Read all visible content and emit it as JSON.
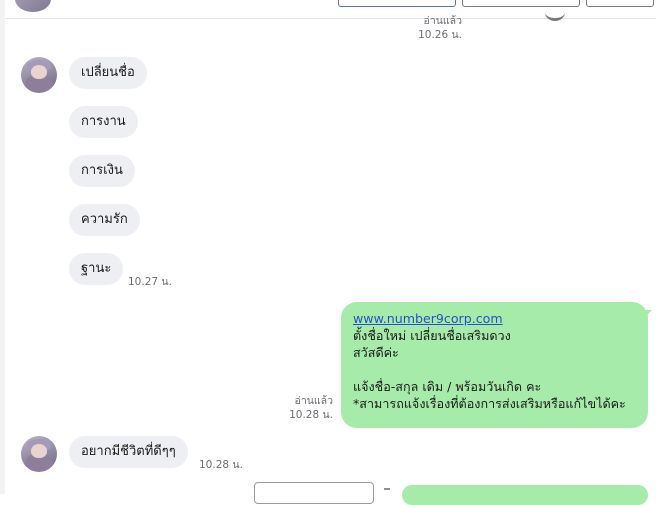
{
  "read_top": {
    "status": "อ่านแล้ว",
    "time": "10.26 น."
  },
  "incoming_group_1": {
    "messages": [
      "เปลี่ยนชื่อ",
      "การงาน",
      "การเงิน",
      "ความรัก",
      "ฐานะ"
    ],
    "time": "10.27 น."
  },
  "outgoing": {
    "link": "www.number9corp.com",
    "lines": [
      "ตั้งชื่อใหม่ เปลี่ยนชื่อเสริมดวง",
      "สวัสดีค่ะ",
      "",
      "แจ้งชื่อ-สกุล เดิม / พร้อมวันเกิด คะ",
      "*สามารถแจ้งเรื่องที่ต้องการส่งเสริมหรือแก้ไขได้คะ"
    ],
    "read_status": "อ่านแล้ว",
    "time": "10.28 น."
  },
  "incoming_group_2": {
    "message": "อยากมีชีวิตที่ดีๆๆ",
    "time": "10.28 น."
  },
  "colors": {
    "outgoing_bubble": "#a6eba9",
    "incoming_bubble": "#eeeff2",
    "link": "#2a4fc9",
    "timestamp": "#6b6e74"
  }
}
